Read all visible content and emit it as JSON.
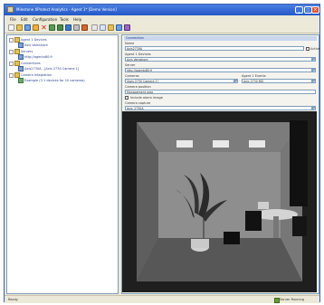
{
  "window": {
    "title": "Milestone XProtect Analytics - Agent 1* [Demo Version]"
  },
  "menu": [
    "File",
    "Edit",
    "Configuration",
    "Tools",
    "Help"
  ],
  "tree": {
    "nodes": [
      {
        "label": "Agent 1 Devices",
        "level": 0,
        "icon": "folder-icon"
      },
      {
        "label": "Axis Vamshore",
        "level": 1,
        "icon": "camera-icon"
      },
      {
        "label": "Servers",
        "level": 0,
        "icon": "folder-icon"
      },
      {
        "label": "http://agentx80:9",
        "level": 1,
        "icon": "server-icon"
      },
      {
        "label": "Connections",
        "level": 0,
        "icon": "folder-icon"
      },
      {
        "label": "Axis2730A - [Axis 2730 Camera 1]",
        "level": 1,
        "icon": "camera-icon"
      },
      {
        "label": "Camera Integration",
        "level": 0,
        "icon": "folder-icon"
      },
      {
        "label": "Example (3.1 devices for 10 cameras)",
        "level": 1,
        "icon": "integration-icon"
      }
    ]
  },
  "form": {
    "group_title": "Connection",
    "name_label": "Name",
    "name_value": "Axis2730A",
    "active_label": "Active",
    "agent_device_label": "Agent 1 Devices",
    "agent_device_value": "Axis Vamshore",
    "server_label": "Server",
    "server_value": "http://agentx80:9",
    "camera_label": "Cameras",
    "camera_value": "[Axis 2730 Camera 1]",
    "agent_events_label": "Agent 1 Events",
    "agent_events_value": "Axis 2730 MD",
    "location_label": "Camera position",
    "location_value": "Management area",
    "include_label": "Include alarm image",
    "preview_label": "Camera capture",
    "preview_value": "Axis_2730A"
  },
  "status": {
    "left": "Ready",
    "right": "Server Running"
  },
  "colors": {
    "titlebar": "#2458c8",
    "group_header": "#c9d6ee",
    "tree_text": "#2b3f8a"
  }
}
